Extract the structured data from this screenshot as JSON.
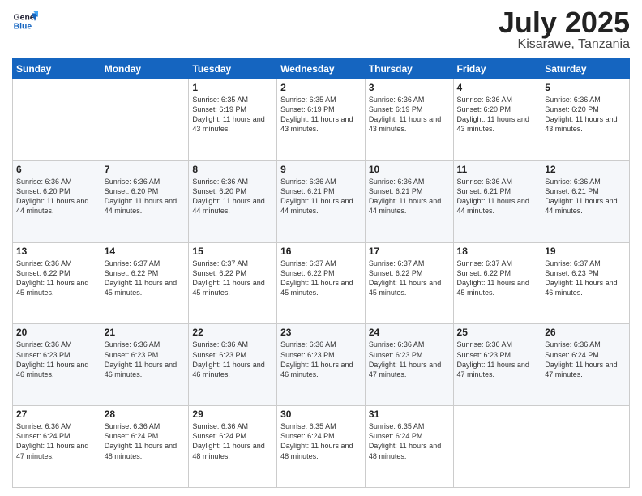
{
  "logo": {
    "line1": "General",
    "line2": "Blue"
  },
  "title": "July 2025",
  "location": "Kisarawe, Tanzania",
  "days_header": [
    "Sunday",
    "Monday",
    "Tuesday",
    "Wednesday",
    "Thursday",
    "Friday",
    "Saturday"
  ],
  "weeks": [
    [
      {
        "day": "",
        "info": ""
      },
      {
        "day": "",
        "info": ""
      },
      {
        "day": "1",
        "info": "Sunrise: 6:35 AM\nSunset: 6:19 PM\nDaylight: 11 hours and 43 minutes."
      },
      {
        "day": "2",
        "info": "Sunrise: 6:35 AM\nSunset: 6:19 PM\nDaylight: 11 hours and 43 minutes."
      },
      {
        "day": "3",
        "info": "Sunrise: 6:36 AM\nSunset: 6:19 PM\nDaylight: 11 hours and 43 minutes."
      },
      {
        "day": "4",
        "info": "Sunrise: 6:36 AM\nSunset: 6:20 PM\nDaylight: 11 hours and 43 minutes."
      },
      {
        "day": "5",
        "info": "Sunrise: 6:36 AM\nSunset: 6:20 PM\nDaylight: 11 hours and 43 minutes."
      }
    ],
    [
      {
        "day": "6",
        "info": "Sunrise: 6:36 AM\nSunset: 6:20 PM\nDaylight: 11 hours and 44 minutes."
      },
      {
        "day": "7",
        "info": "Sunrise: 6:36 AM\nSunset: 6:20 PM\nDaylight: 11 hours and 44 minutes."
      },
      {
        "day": "8",
        "info": "Sunrise: 6:36 AM\nSunset: 6:20 PM\nDaylight: 11 hours and 44 minutes."
      },
      {
        "day": "9",
        "info": "Sunrise: 6:36 AM\nSunset: 6:21 PM\nDaylight: 11 hours and 44 minutes."
      },
      {
        "day": "10",
        "info": "Sunrise: 6:36 AM\nSunset: 6:21 PM\nDaylight: 11 hours and 44 minutes."
      },
      {
        "day": "11",
        "info": "Sunrise: 6:36 AM\nSunset: 6:21 PM\nDaylight: 11 hours and 44 minutes."
      },
      {
        "day": "12",
        "info": "Sunrise: 6:36 AM\nSunset: 6:21 PM\nDaylight: 11 hours and 44 minutes."
      }
    ],
    [
      {
        "day": "13",
        "info": "Sunrise: 6:36 AM\nSunset: 6:22 PM\nDaylight: 11 hours and 45 minutes."
      },
      {
        "day": "14",
        "info": "Sunrise: 6:37 AM\nSunset: 6:22 PM\nDaylight: 11 hours and 45 minutes."
      },
      {
        "day": "15",
        "info": "Sunrise: 6:37 AM\nSunset: 6:22 PM\nDaylight: 11 hours and 45 minutes."
      },
      {
        "day": "16",
        "info": "Sunrise: 6:37 AM\nSunset: 6:22 PM\nDaylight: 11 hours and 45 minutes."
      },
      {
        "day": "17",
        "info": "Sunrise: 6:37 AM\nSunset: 6:22 PM\nDaylight: 11 hours and 45 minutes."
      },
      {
        "day": "18",
        "info": "Sunrise: 6:37 AM\nSunset: 6:22 PM\nDaylight: 11 hours and 45 minutes."
      },
      {
        "day": "19",
        "info": "Sunrise: 6:37 AM\nSunset: 6:23 PM\nDaylight: 11 hours and 46 minutes."
      }
    ],
    [
      {
        "day": "20",
        "info": "Sunrise: 6:36 AM\nSunset: 6:23 PM\nDaylight: 11 hours and 46 minutes."
      },
      {
        "day": "21",
        "info": "Sunrise: 6:36 AM\nSunset: 6:23 PM\nDaylight: 11 hours and 46 minutes."
      },
      {
        "day": "22",
        "info": "Sunrise: 6:36 AM\nSunset: 6:23 PM\nDaylight: 11 hours and 46 minutes."
      },
      {
        "day": "23",
        "info": "Sunrise: 6:36 AM\nSunset: 6:23 PM\nDaylight: 11 hours and 46 minutes."
      },
      {
        "day": "24",
        "info": "Sunrise: 6:36 AM\nSunset: 6:23 PM\nDaylight: 11 hours and 47 minutes."
      },
      {
        "day": "25",
        "info": "Sunrise: 6:36 AM\nSunset: 6:23 PM\nDaylight: 11 hours and 47 minutes."
      },
      {
        "day": "26",
        "info": "Sunrise: 6:36 AM\nSunset: 6:24 PM\nDaylight: 11 hours and 47 minutes."
      }
    ],
    [
      {
        "day": "27",
        "info": "Sunrise: 6:36 AM\nSunset: 6:24 PM\nDaylight: 11 hours and 47 minutes."
      },
      {
        "day": "28",
        "info": "Sunrise: 6:36 AM\nSunset: 6:24 PM\nDaylight: 11 hours and 48 minutes."
      },
      {
        "day": "29",
        "info": "Sunrise: 6:36 AM\nSunset: 6:24 PM\nDaylight: 11 hours and 48 minutes."
      },
      {
        "day": "30",
        "info": "Sunrise: 6:35 AM\nSunset: 6:24 PM\nDaylight: 11 hours and 48 minutes."
      },
      {
        "day": "31",
        "info": "Sunrise: 6:35 AM\nSunset: 6:24 PM\nDaylight: 11 hours and 48 minutes."
      },
      {
        "day": "",
        "info": ""
      },
      {
        "day": "",
        "info": ""
      }
    ]
  ]
}
